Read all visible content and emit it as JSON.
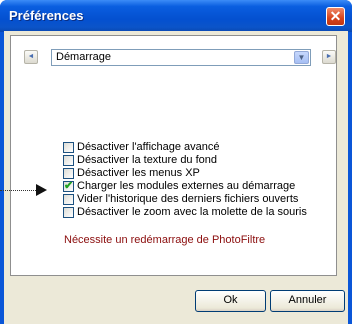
{
  "window": {
    "title": "Préférences",
    "close_glyph": "✕"
  },
  "page_selector": {
    "value": "Démarrage",
    "prev_glyph": "◄",
    "next_glyph": "►",
    "dropdown_glyph": "▼"
  },
  "options": [
    {
      "label": "Désactiver l'affichage avancé",
      "checked": false
    },
    {
      "label": "Désactiver la texture du fond",
      "checked": false
    },
    {
      "label": "Désactiver les menus XP",
      "checked": false
    },
    {
      "label": "Charger les modules externes au démarrage",
      "checked": true
    },
    {
      "label": "Vider l'historique des derniers fichiers ouverts",
      "checked": false
    },
    {
      "label": "Désactiver le zoom avec la molette de la souris",
      "checked": false
    }
  ],
  "notice": "Nécessite un redémarrage de PhotoFiltre",
  "buttons": {
    "ok": "Ok",
    "cancel": "Annuler"
  },
  "colors": {
    "titlebar": "#0450d0",
    "notice_text": "#8b0d0d",
    "checkmark": "#21a121"
  }
}
